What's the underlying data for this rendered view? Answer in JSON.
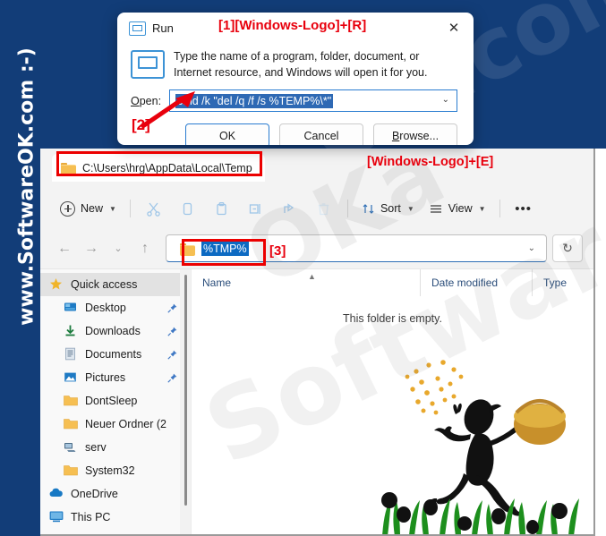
{
  "watermark": {
    "rail_text": "www.SoftwareOK.com :-)",
    "ghost_top": "OK.com",
    "ghost_mid": "OKa",
    "ghost_low": "Software"
  },
  "annotations": {
    "step1": "[1][Windows-Logo]+[R]",
    "step2": "[2]",
    "step3": "[3]",
    "win_e": "[Windows-Logo]+[E]",
    "box_color": "#ec0000",
    "text_color": "#e8000d"
  },
  "run_dialog": {
    "title": "Run",
    "close_label": "✕",
    "description": "Type the name of a program, folder, document, or Internet resource, and Windows will open it for you.",
    "open_label": "Open:",
    "command_value": "cmd /k \"del /q /f /s %TEMP%\\*\"",
    "combo_chevron": "⌄",
    "buttons": [
      {
        "label": "OK",
        "primary": true
      },
      {
        "label": "Cancel",
        "primary": false
      },
      {
        "label": "Browse...",
        "primary": false
      }
    ]
  },
  "explorer": {
    "tab_title": "C:\\Users\\hrg\\AppData\\Local\\Temp",
    "toolbar": {
      "new_label": "New",
      "sort_label": "Sort",
      "view_label": "View",
      "more_label": "•••",
      "icons": [
        "cut-icon",
        "copy-icon",
        "paste-icon",
        "rename-icon",
        "share-icon",
        "delete-icon"
      ]
    },
    "address": {
      "back": "←",
      "forward": "→",
      "recent": "⌄",
      "up": "↑",
      "value": "%TMP%",
      "chevron": "⌄",
      "refresh": "↻"
    },
    "nav_pane": {
      "items": [
        {
          "label": "Quick access",
          "icon": "star-icon",
          "selected": true,
          "pinned": false,
          "indent": false
        },
        {
          "label": "Desktop",
          "icon": "desktop-icon",
          "selected": false,
          "pinned": true,
          "indent": true
        },
        {
          "label": "Downloads",
          "icon": "download-icon",
          "selected": false,
          "pinned": true,
          "indent": true
        },
        {
          "label": "Documents",
          "icon": "document-icon",
          "selected": false,
          "pinned": true,
          "indent": true
        },
        {
          "label": "Pictures",
          "icon": "pictures-icon",
          "selected": false,
          "pinned": true,
          "indent": true
        },
        {
          "label": "DontSleep",
          "icon": "folder-icon",
          "selected": false,
          "pinned": false,
          "indent": true
        },
        {
          "label": "Neuer Ordner (2",
          "icon": "folder-icon",
          "selected": false,
          "pinned": false,
          "indent": true
        },
        {
          "label": "serv",
          "icon": "network-icon",
          "selected": false,
          "pinned": false,
          "indent": true
        },
        {
          "label": "System32",
          "icon": "folder-icon",
          "selected": false,
          "pinned": false,
          "indent": true
        },
        {
          "label": "OneDrive",
          "icon": "cloud-icon",
          "selected": false,
          "pinned": false,
          "indent": false
        },
        {
          "label": "This PC",
          "icon": "pc-icon",
          "selected": false,
          "pinned": false,
          "indent": false
        }
      ]
    },
    "columns": [
      {
        "label": "Name"
      },
      {
        "label": "Date modified"
      },
      {
        "label": "Type"
      }
    ],
    "empty_message": "This folder is empty."
  }
}
